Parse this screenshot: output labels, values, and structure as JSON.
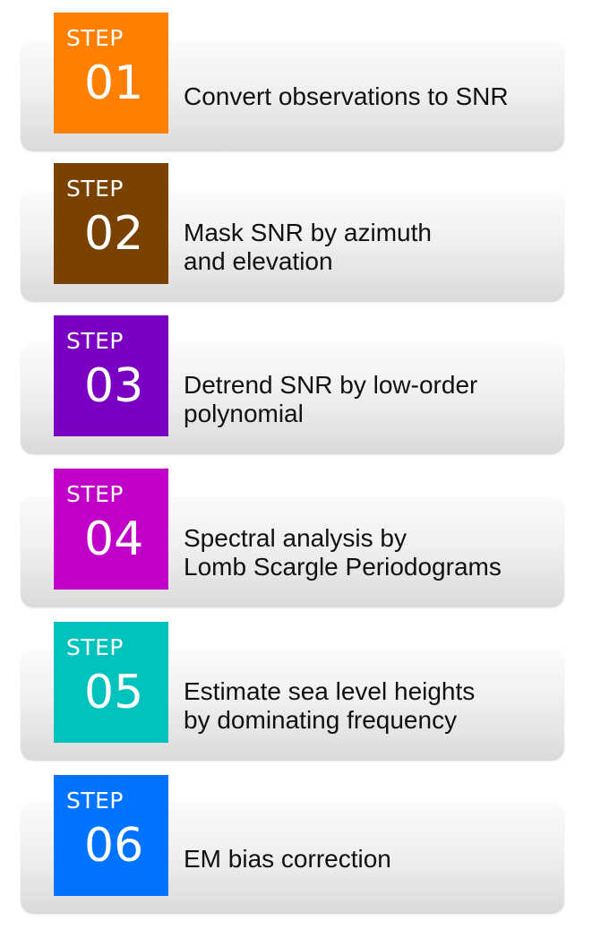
{
  "steps": [
    {
      "label": "STEP",
      "number": "01",
      "color": "#ff7f00",
      "lines": [
        "Convert observations to SNR"
      ]
    },
    {
      "label": "STEP",
      "number": "02",
      "color": "#7a4200",
      "lines": [
        "Mask SNR by azimuth",
        "and elevation"
      ]
    },
    {
      "label": "STEP",
      "number": "03",
      "color": "#7a00c2",
      "lines": [
        "Detrend SNR by low-order",
        "polynomial"
      ]
    },
    {
      "label": "STEP",
      "number": "04",
      "color": "#c000c8",
      "lines": [
        "Spectral analysis by",
        "Lomb Scargle Periodograms"
      ]
    },
    {
      "label": "STEP",
      "number": "05",
      "color": "#00c2bd",
      "lines": [
        "Estimate sea level heights",
        "by dominating frequency"
      ]
    },
    {
      "label": "STEP",
      "number": "06",
      "color": "#0073ff",
      "lines": [
        "EM bias correction"
      ]
    }
  ]
}
